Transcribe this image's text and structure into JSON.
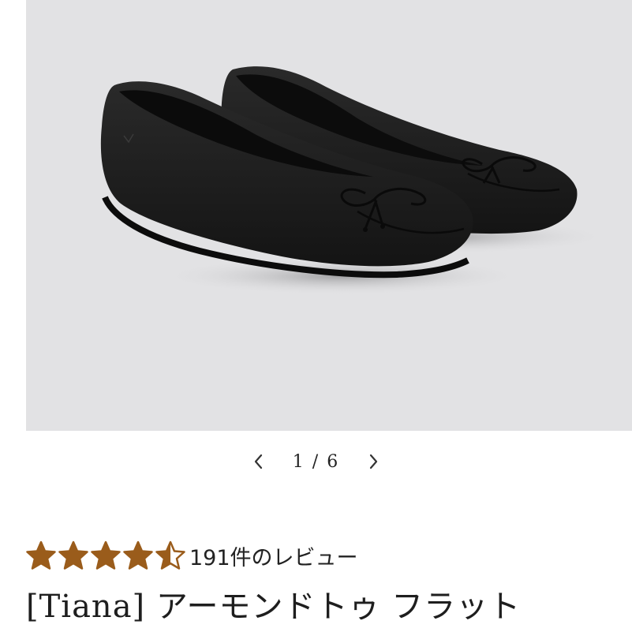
{
  "gallery": {
    "image_alt": "black knit ballet flats with bow",
    "current_page": "1",
    "separator": "/",
    "total_pages": "6",
    "prev_icon": "chevron-left-icon",
    "next_icon": "chevron-right-icon"
  },
  "product": {
    "rating_value": 4.5,
    "rating_max": 5,
    "star_color": "#9a5c1b",
    "reviews_text": "191件のレビュー",
    "title": "[Tiana] アーモンドトゥ フラット"
  }
}
